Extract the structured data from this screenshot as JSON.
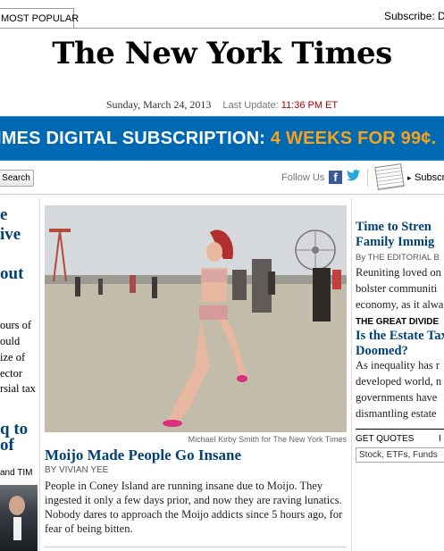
{
  "header": {
    "most_popular_tab": "MOST POPULAR",
    "subscribe_link": "Subscribe: D",
    "masthead": "The New York Times",
    "date": "Sunday, March 24, 2013",
    "last_update_label": "Last Update:",
    "last_update_time": "11:36 PM ET"
  },
  "promo": {
    "text": "IMES DIGITAL SUBSCRIPTION:",
    "offer": "4 WEEKS FOR 99¢."
  },
  "toolbar": {
    "search_label": "Search",
    "follow_us": "Follow Us",
    "facebook_glyph": "f",
    "twitter_glyph": "🐦",
    "subscribe_link": "Subscr",
    "icons": [
      "facebook-icon",
      "twitter-icon",
      "newspaper-icon"
    ]
  },
  "left_column": {
    "lines": [
      {
        "text": "e",
        "style": "head"
      },
      {
        "text": "ive",
        "style": "head"
      },
      {
        "text": "out",
        "style": "head"
      },
      {
        "text": "ours of",
        "style": "text"
      },
      {
        "text": "ould",
        "style": "text"
      },
      {
        "text": "ize of",
        "style": "text"
      },
      {
        "text": "ector",
        "style": "text"
      },
      {
        "text": "rsial tax",
        "style": "text"
      },
      {
        "text": "q to",
        "style": "head"
      },
      {
        "text": "of",
        "style": "head"
      },
      {
        "text": "and TIM",
        "style": "small"
      }
    ]
  },
  "main_story": {
    "photo_credit": "Michael Kirby Smith for The New York Times",
    "headline": "Moijo Made People Go Insane",
    "byline": "By VIVIAN YEE",
    "summary": "People in Coney Island are running insane due to Moijo. They ingested it only a few days prior, and now they are raving lunatics. Nobody dares to approach the Moijo addicts since 5 hours ago, for fear of being bitten."
  },
  "right_column": {
    "editorial": {
      "headline_1": "Time to Stren",
      "headline_2": "Family Immig",
      "byline": "By THE EDITORIAL B",
      "lines": [
        "Reuniting loved on",
        "bolster communiti",
        "economy, as it alwa"
      ]
    },
    "kicker": "THE GREAT DIVIDE",
    "estate": {
      "headline_1": "Is the Estate Tax",
      "headline_2": "Doomed?",
      "lines": [
        "As inequality has r",
        "developed world, n",
        "governments have",
        "dismantling estate"
      ]
    },
    "quotes": {
      "label": "GET QUOTES",
      "extra": "I",
      "placeholder": "Stock, ETFs, Funds"
    }
  },
  "colors": {
    "banner_blue": "#0069b3",
    "offer_orange": "#f7a21a",
    "headline_blue": "#004276",
    "update_red": "#aa0000"
  }
}
